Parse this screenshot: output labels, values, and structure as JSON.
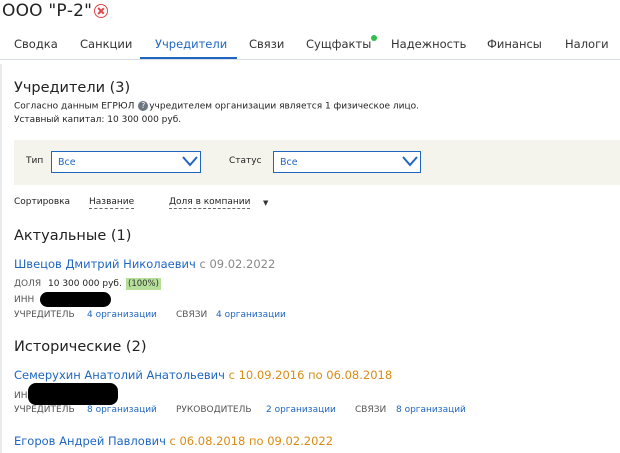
{
  "header": {
    "company_name": "ООО \"Р-2\"",
    "close_icon": "close-circle-icon"
  },
  "tabs": [
    {
      "label": "Сводка",
      "active": false
    },
    {
      "label": "Санкции",
      "active": false
    },
    {
      "label": "Учредители",
      "active": true
    },
    {
      "label": "Связи",
      "active": false
    },
    {
      "label": "Сущфакты",
      "active": false,
      "indicator": "#2fbf4a"
    },
    {
      "label": "Надежность",
      "active": false
    },
    {
      "label": "Финансы",
      "active": false
    },
    {
      "label": "Налоги",
      "active": false
    }
  ],
  "founders": {
    "title": "Учредители (3)",
    "info_before": "Согласно данным ЕГРЮЛ",
    "info_after": "учредителем организации является 1 физическое лицо.",
    "capital": "Уставный капитал: 10 300 000 руб."
  },
  "filters": {
    "type_label": "Тип",
    "type_value": "Все",
    "status_label": "Статус",
    "status_value": "Все"
  },
  "sort": {
    "label": "Сортировка",
    "by_name": "Название",
    "by_share": "Доля в компании"
  },
  "actual": {
    "title": "Актуальные (1)",
    "person": {
      "name": "Швецов Дмитрий Николаевич",
      "since": "с 09.02.2022",
      "share_label": "ДОЛЯ",
      "share_value": "10 300 000 руб.",
      "share_percent": "(100%)",
      "inn_label": "ИНН",
      "role_label": "УЧРЕДИТЕЛЬ",
      "role_link": "4 организации",
      "links_label": "СВЯЗИ",
      "links_link": "4 организации"
    }
  },
  "historical": {
    "title": "Исторические (2)",
    "persons": [
      {
        "name": "Семерухин Анатолий Анатольевич",
        "period": "с 10.09.2016 по 06.08.2018",
        "inn_label": "ИНН",
        "role_label": "УЧРЕДИТЕЛЬ",
        "role_link": "8 организаций",
        "head_label": "РУКОВОДИТЕЛЬ",
        "head_link": "2 организации",
        "links_label": "СВЯЗИ",
        "links_link": "8 организаций"
      },
      {
        "name": "Егоров Андрей Павлович",
        "period": "с 06.08.2018 по 09.02.2022"
      }
    ]
  },
  "colors": {
    "accent": "#1f66c1",
    "historical_date": "#d98c14",
    "share_highlight": "#b6e09a",
    "filter_panel": "#f4f4ec"
  }
}
